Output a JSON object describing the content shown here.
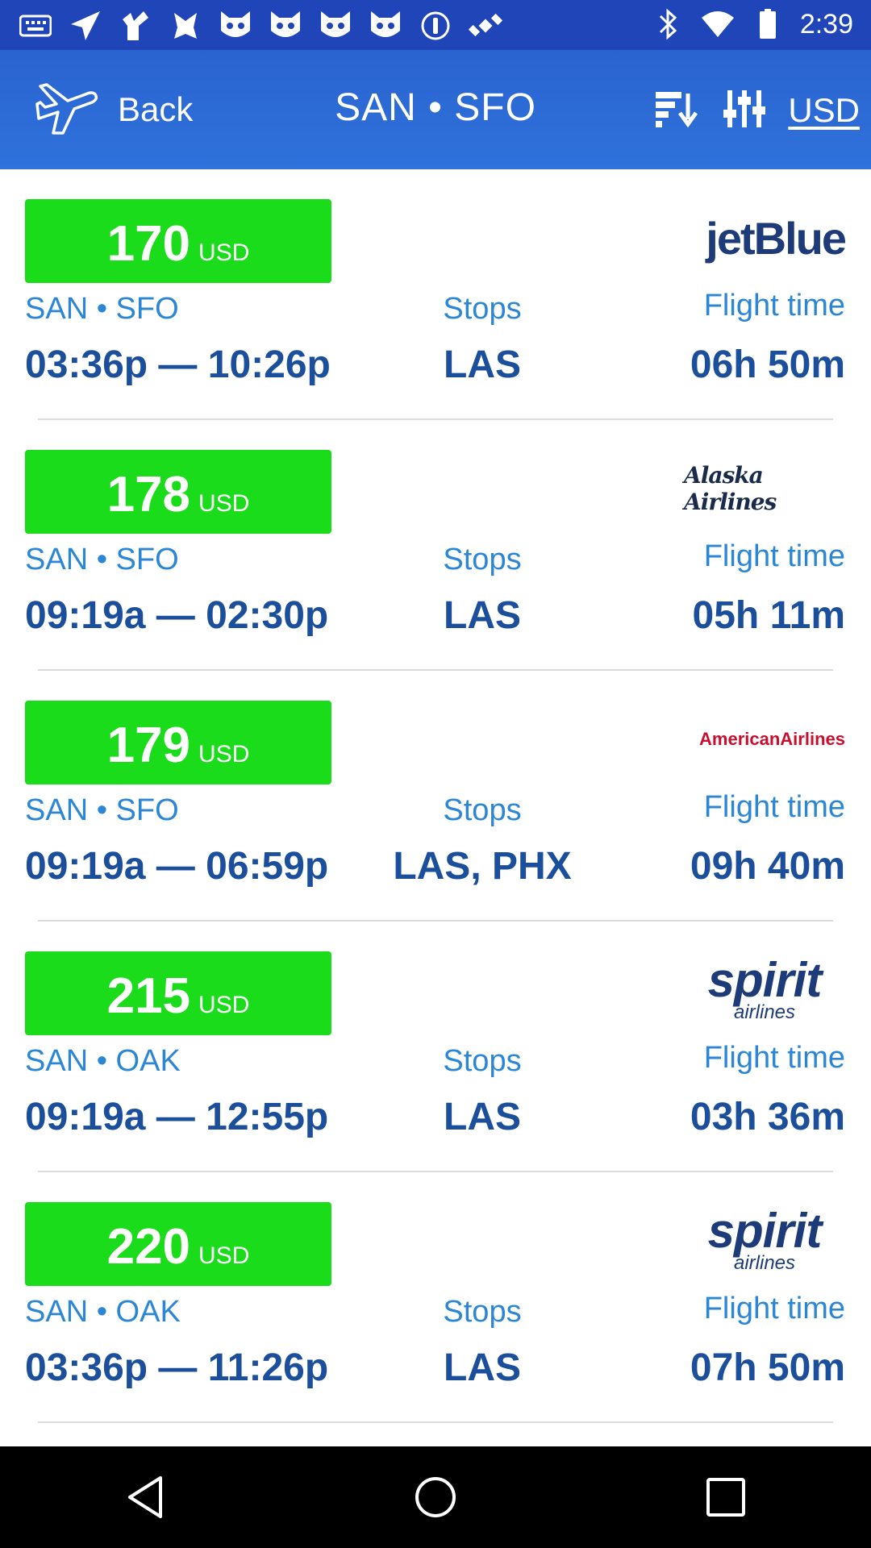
{
  "status_bar": {
    "time": "2:39",
    "left_icons": [
      "notification-icon",
      "send-icon",
      "drawing-icon",
      "app-icon",
      "cat-icon",
      "cat-icon",
      "cat-icon",
      "cat-icon",
      "signal-icon",
      "satellite-icon"
    ],
    "right_icons": [
      "bluetooth-icon",
      "wifi-icon",
      "battery-icon"
    ]
  },
  "header": {
    "back_label": "Back",
    "route_origin": "SAN",
    "route_separator": "•",
    "route_destination": "SFO",
    "currency": "USD"
  },
  "flights": [
    {
      "price": "170",
      "currency": "USD",
      "airline": "jetBlue",
      "route": "SAN • SFO",
      "times": "03:36p — 10:26p",
      "stops_label": "Stops",
      "stops": "LAS",
      "flight_time_label": "Flight time",
      "flight_time": "06h 50m"
    },
    {
      "price": "178",
      "currency": "USD",
      "airline": "Alaska Airlines",
      "route": "SAN • SFO",
      "times": "09:19a — 02:30p",
      "stops_label": "Stops",
      "stops": "LAS",
      "flight_time_label": "Flight time",
      "flight_time": "05h 11m"
    },
    {
      "price": "179",
      "currency": "USD",
      "airline": "AmericanAirlines",
      "route": "SAN • SFO",
      "times": "09:19a — 06:59p",
      "stops_label": "Stops",
      "stops": "LAS, PHX",
      "flight_time_label": "Flight time",
      "flight_time": "09h 40m"
    },
    {
      "price": "215",
      "currency": "USD",
      "airline": "spirit",
      "airline_sub": "airlines",
      "route": "SAN • OAK",
      "times": "09:19a — 12:55p",
      "stops_label": "Stops",
      "stops": "LAS",
      "flight_time_label": "Flight time",
      "flight_time": "03h 36m"
    },
    {
      "price": "220",
      "currency": "USD",
      "airline": "spirit",
      "airline_sub": "airlines",
      "route": "SAN • OAK",
      "times": "03:36p — 11:26p",
      "stops_label": "Stops",
      "stops": "LAS",
      "flight_time_label": "Flight time",
      "flight_time": "07h 50m"
    }
  ],
  "colors": {
    "status_bar": "#1f45b8",
    "app_bar": "#2f72dc",
    "price_badge": "#1bdc1b",
    "label_blue": "#2c86d6",
    "value_navy": "#1b4f9c",
    "american_red": "#c8102e",
    "spirit_navy": "#1d3b78"
  }
}
